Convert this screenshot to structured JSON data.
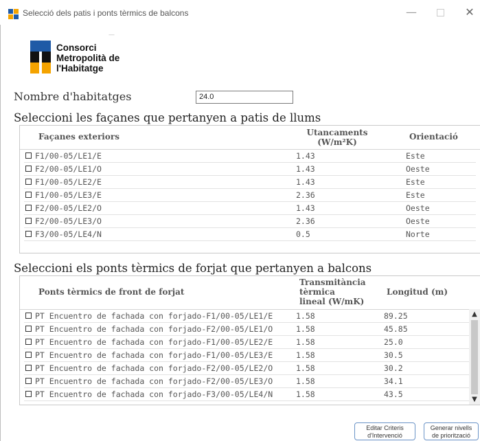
{
  "window": {
    "title": "Selecció dels patis i ponts tèrmics de balcons"
  },
  "logo": {
    "lines": [
      "Consorci",
      "Metropolità de",
      "l'Habitatge"
    ]
  },
  "habitatges": {
    "label": "Nombre d'habitatges",
    "value": "24.0"
  },
  "patis": {
    "title": "Seleccioni les façanes que pertanyen a patis de llums",
    "columns": [
      "Façanes exteriors",
      "Utancaments (W/m²K)",
      "Orientació"
    ],
    "rows": [
      {
        "name": "F1/00-05/LE1/E",
        "u": "1.43",
        "orient": "Este"
      },
      {
        "name": "F2/00-05/LE1/O",
        "u": "1.43",
        "orient": "Oeste"
      },
      {
        "name": "F1/00-05/LE2/E",
        "u": "1.43",
        "orient": "Este"
      },
      {
        "name": "F1/00-05/LE3/E",
        "u": "2.36",
        "orient": "Este"
      },
      {
        "name": "F2/00-05/LE2/O",
        "u": "1.43",
        "orient": "Oeste"
      },
      {
        "name": "F2/00-05/LE3/O",
        "u": "2.36",
        "orient": "Oeste"
      },
      {
        "name": "F3/00-05/LE4/N",
        "u": "0.5",
        "orient": "Norte"
      }
    ]
  },
  "ponts": {
    "title": "Seleccioni els ponts tèrmics de forjat que pertanyen a balcons",
    "columns": [
      "Ponts tèrmics de front de forjat",
      "Transmitància tèrmica lineal (W/mK)",
      "Longitud (m)"
    ],
    "rows": [
      {
        "name": "PT Encuentro de fachada con forjado-F1/00-05/LE1/E",
        "psi": "1.58",
        "len": "89.25"
      },
      {
        "name": "PT Encuentro de fachada con forjado-F2/00-05/LE1/O",
        "psi": "1.58",
        "len": "45.85"
      },
      {
        "name": "PT Encuentro de fachada con forjado-F1/00-05/LE2/E",
        "psi": "1.58",
        "len": "25.0"
      },
      {
        "name": "PT Encuentro de fachada con forjado-F1/00-05/LE3/E",
        "psi": "1.58",
        "len": "30.5"
      },
      {
        "name": "PT Encuentro de fachada con forjado-F2/00-05/LE2/O",
        "psi": "1.58",
        "len": "30.2"
      },
      {
        "name": "PT Encuentro de fachada con forjado-F2/00-05/LE3/O",
        "psi": "1.58",
        "len": "34.1"
      },
      {
        "name": "PT Encuentro de fachada con forjado-F3/00-05/LE4/N",
        "psi": "1.58",
        "len": "43.5"
      }
    ]
  },
  "buttons": {
    "editar": [
      "Editar Criteris",
      "d'Intervenció"
    ],
    "generar": [
      "Generar nivells",
      "de priorització"
    ]
  },
  "colors": {
    "logo_blue": "#1f5aa6",
    "logo_orange": "#f4a300",
    "logo_black": "#111111",
    "button_border": "#6a93c7"
  },
  "icons": [
    "app-icon",
    "minimize-icon",
    "maximize-icon",
    "close-icon",
    "checkbox",
    "scroll-up-arrow-icon",
    "scroll-down-arrow-icon"
  ]
}
